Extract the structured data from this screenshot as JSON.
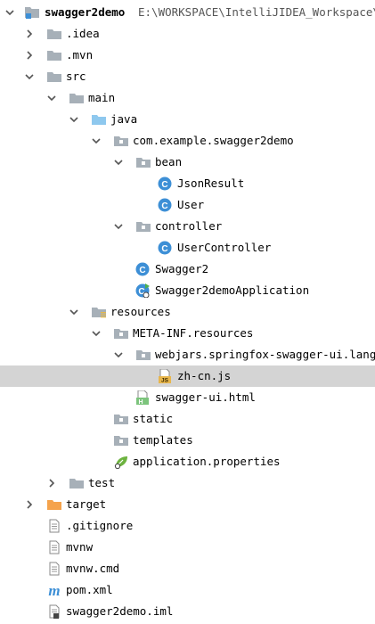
{
  "project_tree": {
    "root": {
      "name": "swagger2demo",
      "path": "E:\\WORKSPACE\\IntelliJIDEA_Workspace\\sw"
    },
    "items": [
      {
        "label": ".idea"
      },
      {
        "label": ".mvn"
      },
      {
        "label": "src"
      },
      {
        "label": "main"
      },
      {
        "label": "java"
      },
      {
        "label": "com.example.swagger2demo"
      },
      {
        "label": "bean"
      },
      {
        "label": "JsonResult"
      },
      {
        "label": "User"
      },
      {
        "label": "controller"
      },
      {
        "label": "UserController"
      },
      {
        "label": "Swagger2"
      },
      {
        "label": "Swagger2demoApplication"
      },
      {
        "label": "resources"
      },
      {
        "label": "META-INF.resources"
      },
      {
        "label": "webjars.springfox-swagger-ui.lang"
      },
      {
        "label": "zh-cn.js"
      },
      {
        "label": "swagger-ui.html"
      },
      {
        "label": "static"
      },
      {
        "label": "templates"
      },
      {
        "label": "application.properties"
      },
      {
        "label": "test"
      },
      {
        "label": "target"
      },
      {
        "label": ".gitignore"
      },
      {
        "label": "mvnw"
      },
      {
        "label": "mvnw.cmd"
      },
      {
        "label": "pom.xml"
      },
      {
        "label": "swagger2demo.iml"
      }
    ]
  },
  "icons": {
    "class_letter": "C",
    "js_badge": "JS",
    "html_badge": "H",
    "maven_letter": "m"
  },
  "colors": {
    "selection": "#d4d4d4",
    "folder_grey": "#9aa4ad",
    "folder_blue": "#8ec8ee",
    "folder_orange": "#f5a34c",
    "class_blue": "#3d8fd6",
    "spring_green": "#6db33f"
  }
}
